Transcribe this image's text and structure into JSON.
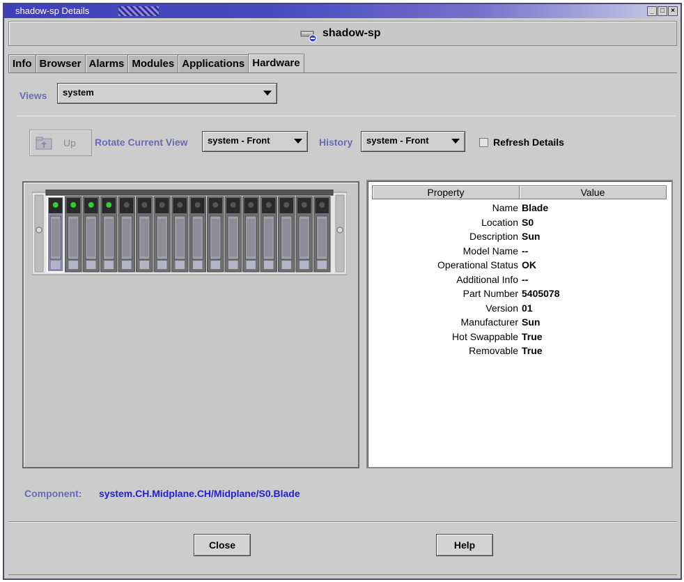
{
  "window": {
    "title": "shadow-sp Details",
    "controls": [
      "minimize",
      "maximize",
      "close"
    ]
  },
  "host": {
    "name": "shadow-sp",
    "icon": "server-icon"
  },
  "tabs": [
    {
      "label": "Info",
      "active": false
    },
    {
      "label": "Browser",
      "active": false
    },
    {
      "label": "Alarms",
      "active": false
    },
    {
      "label": "Modules",
      "active": false
    },
    {
      "label": "Applications",
      "active": false
    },
    {
      "label": "Hardware",
      "active": true
    }
  ],
  "views": {
    "label": "Views",
    "selected": "system"
  },
  "toolbar": {
    "up_label": "Up",
    "rotate_label": "Rotate Current View",
    "rotate_selected": "system - Front",
    "history_label": "History",
    "history_selected": "system - Front",
    "refresh_label": "Refresh Details",
    "refresh_checked": false
  },
  "properties": {
    "col_property": "Property",
    "col_value": "Value",
    "rows": [
      {
        "property": "Name",
        "value": "Blade"
      },
      {
        "property": "Location",
        "value": "S0"
      },
      {
        "property": "Description",
        "value": "Sun"
      },
      {
        "property": "Model Name",
        "value": "--"
      },
      {
        "property": "Operational Status",
        "value": "OK"
      },
      {
        "property": "Additional Info",
        "value": "--"
      },
      {
        "property": "Part Number",
        "value": "5405078"
      },
      {
        "property": "Version",
        "value": "01"
      },
      {
        "property": "Manufacturer",
        "value": "Sun"
      },
      {
        "property": "Hot Swappable",
        "value": "True"
      },
      {
        "property": "Removable",
        "value": "True"
      }
    ]
  },
  "component": {
    "label": "Component:",
    "value": "system.CH.Midplane.CH/Midplane/S0.Blade"
  },
  "buttons": {
    "close": "Close",
    "help": "Help"
  },
  "colors": {
    "title_bar": "#3f3fb8",
    "label_blue": "#6a6ab4",
    "link_blue": "#2222cc",
    "background": "#cccccc"
  }
}
